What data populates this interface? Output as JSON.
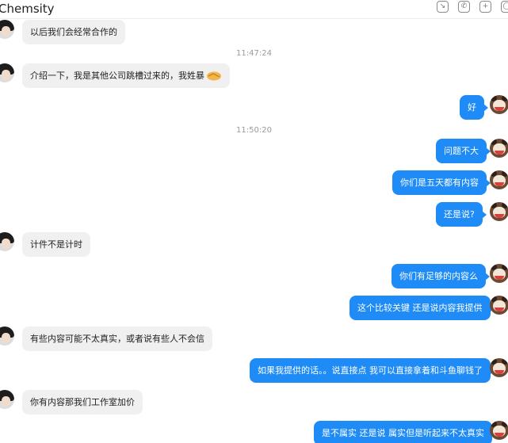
{
  "header": {
    "title": "Chemsity",
    "icons": [
      "minimize-icon",
      "phone-icon",
      "add-icon",
      "more-icon"
    ]
  },
  "messages": [
    {
      "side": "left",
      "text": "以后我们会经常合作的"
    },
    {
      "type": "time",
      "text": "11:47:24"
    },
    {
      "side": "left",
      "text": "介绍一下，我是其他公司跳槽过来的，我姓暴",
      "emoji": "handshake-icon"
    },
    {
      "side": "right",
      "text": "好"
    },
    {
      "type": "time",
      "text": "11:50:20"
    },
    {
      "side": "right",
      "text": "问题不大"
    },
    {
      "side": "right",
      "text": "你们是五天都有内容"
    },
    {
      "side": "right",
      "text": "还是说?"
    },
    {
      "side": "left",
      "text": "计件不是计时"
    },
    {
      "side": "right",
      "text": "你们有足够的内容么"
    },
    {
      "side": "right",
      "text": "这个比较关键 还是说内容我提供"
    },
    {
      "side": "left",
      "text": "有些内容可能不太真实，或者说有些人不会信"
    },
    {
      "side": "right",
      "text": "如果我提供的话。。说直接点 我可以直接拿着和斗鱼聊钱了"
    },
    {
      "side": "left",
      "text": "你有内容那我们工作室加价"
    },
    {
      "side": "right",
      "text": "是不属实 还是说 属实但是听起来不太真实"
    }
  ]
}
